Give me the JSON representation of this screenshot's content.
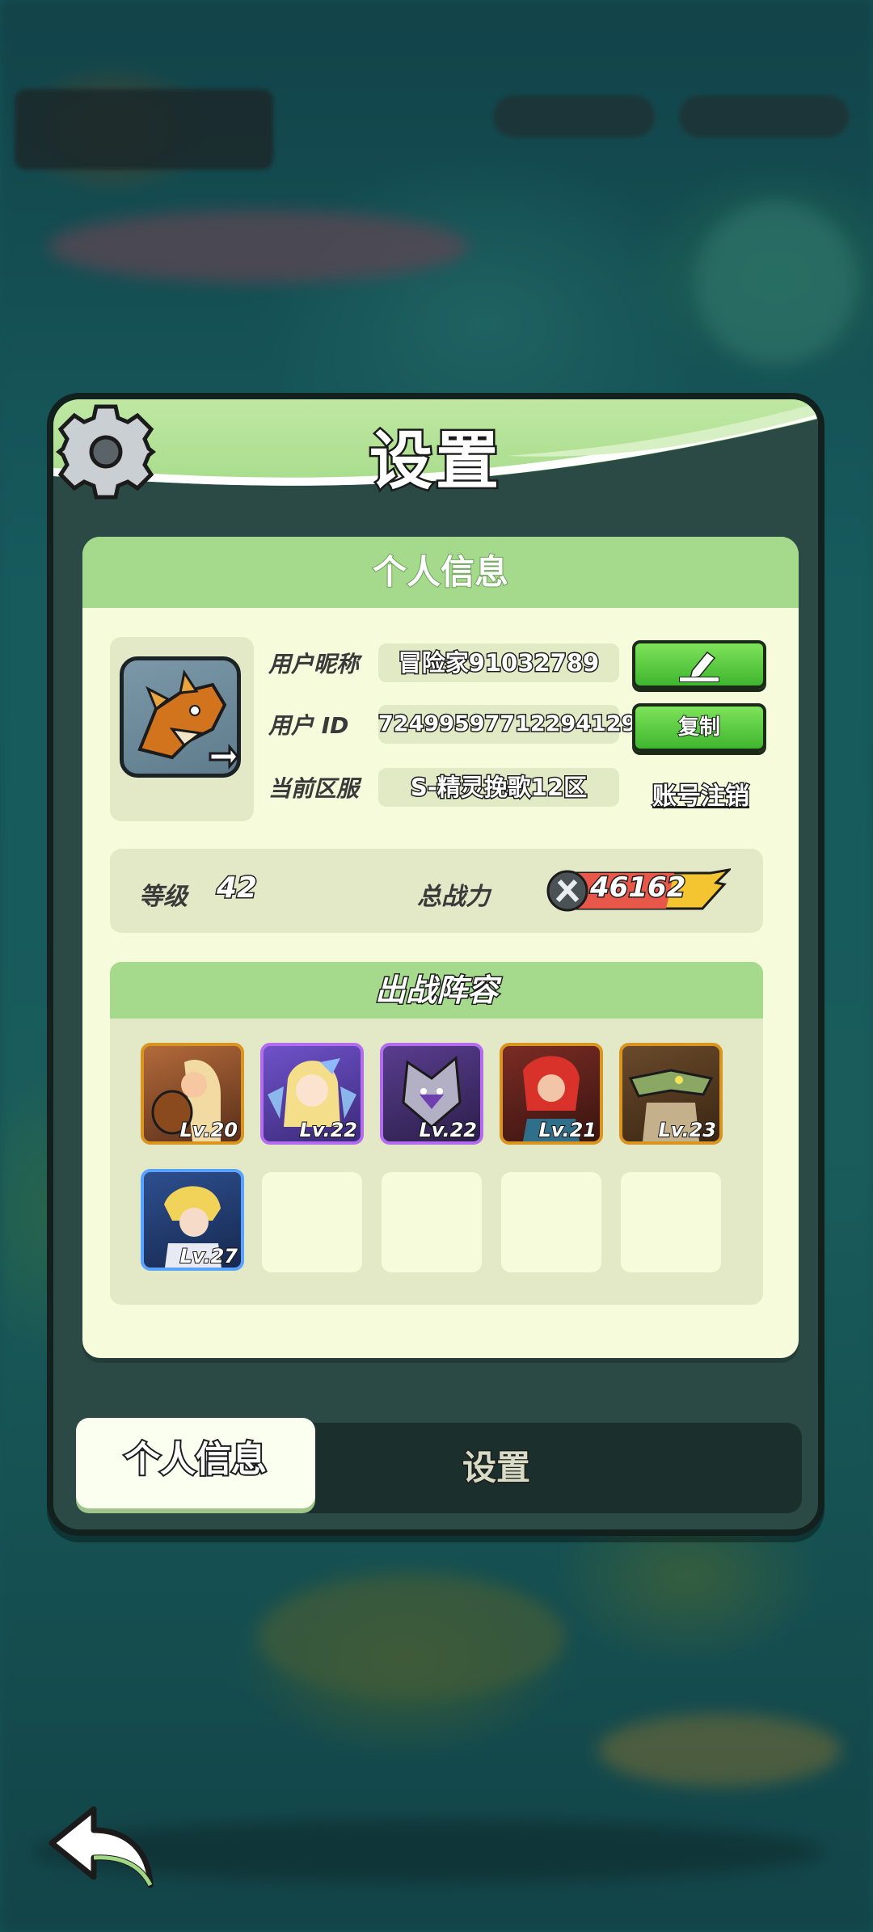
{
  "panel": {
    "title": "设置",
    "card_title": "个人信息"
  },
  "profile": {
    "nickname_label": "用户昵称",
    "nickname": "冒险家91032789",
    "id_label": "用户  ID",
    "user_id": "7249959771229412​9",
    "server_label": "当前区服",
    "server": "S-精灵挽歌12区",
    "edit_icon": "pencil-icon",
    "copy_label": "复制",
    "logout_label": "账号注销"
  },
  "stats": {
    "level_label": "等级",
    "level": "42",
    "power_label": "总战力",
    "power": "46162"
  },
  "lineup": {
    "title": "出战阵容",
    "heroes": [
      {
        "level": "Lv.20",
        "rarity": "gold"
      },
      {
        "level": "Lv.22",
        "rarity": "purple"
      },
      {
        "level": "Lv.22",
        "rarity": "purple"
      },
      {
        "level": "Lv.21",
        "rarity": "gold"
      },
      {
        "level": "Lv.23",
        "rarity": "gold"
      },
      {
        "level": "Lv.27",
        "rarity": "blue"
      }
    ],
    "empty_slots": 4
  },
  "tabs": [
    {
      "label": "个人信息",
      "active": true
    },
    {
      "label": "设置",
      "active": false
    }
  ],
  "colors": {
    "header_green": "#a5d98c",
    "button_green": "#3fb52f",
    "card_bg": "#f6fbdc",
    "gold_frame": "#d9951f",
    "purple_frame": "#b36cf0",
    "blue_frame": "#5aa2ff"
  }
}
